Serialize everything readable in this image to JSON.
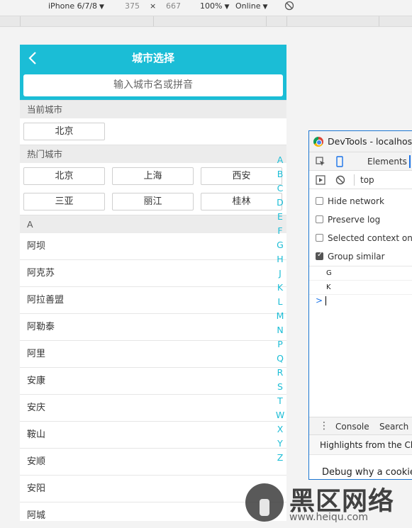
{
  "toolbar": {
    "device": "iPhone 6/7/8",
    "width": "375",
    "times": "×",
    "height": "667",
    "zoom": "100%",
    "network": "Online",
    "caret": "▼"
  },
  "header": {
    "title": "城市选择",
    "back_icon": "chevron-left-icon",
    "search_placeholder": "输入城市名或拼音",
    "bg_color": "#1bbdd6"
  },
  "current_city": {
    "label": "当前城市",
    "city": "北京"
  },
  "hot_cities": {
    "label": "热门城市",
    "cities": [
      "北京",
      "上海",
      "西安",
      "三亚",
      "丽江",
      "桂林"
    ]
  },
  "list": {
    "letter": "A",
    "items": [
      "阿坝",
      "阿克苏",
      "阿拉善盟",
      "阿勒泰",
      "阿里",
      "安康",
      "安庆",
      "鞍山",
      "安顺",
      "安阳",
      "阿城"
    ]
  },
  "index_letters": [
    "A",
    "B",
    "C",
    "D",
    "E",
    "F",
    "G",
    "H",
    "J",
    "K",
    "L",
    "M",
    "N",
    "P",
    "Q",
    "R",
    "S",
    "T",
    "W",
    "X",
    "Y",
    "Z"
  ],
  "devtools": {
    "title": "DevTools - localhost:",
    "tab_elements": "Elements",
    "context": "top",
    "options": [
      {
        "label": "Hide network",
        "checked": false
      },
      {
        "label": "Preserve log",
        "checked": false
      },
      {
        "label": "Selected context only",
        "checked": false
      },
      {
        "label": "Group similar",
        "checked": true
      }
    ],
    "logs": [
      "G",
      "K"
    ],
    "prompt": ">",
    "drawer_tabs": [
      "Console",
      "Search"
    ],
    "highlights": "Highlights from the Chro",
    "debug": "Debug why a cookie"
  },
  "watermark": {
    "text": "黑区网络",
    "url": "www.heiqu.com"
  }
}
